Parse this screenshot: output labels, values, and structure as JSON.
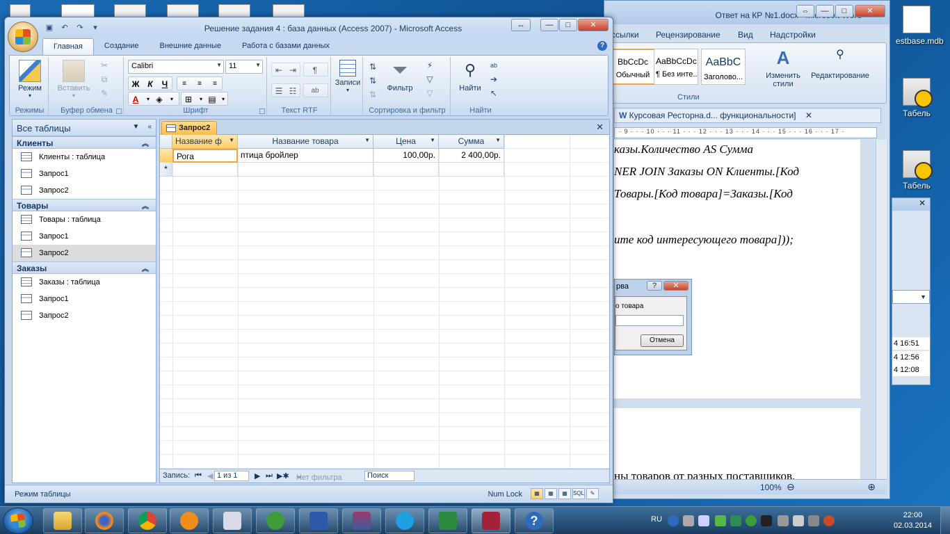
{
  "desktop": {
    "icons": [
      {
        "label": "estbase.mdb"
      },
      {
        "label": "Табель"
      },
      {
        "label": "Табель"
      }
    ]
  },
  "word": {
    "title": "Ответ на КР №1.docx - Microsoft Word",
    "tabs": [
      "ссылки",
      "Рецензирование",
      "Вид",
      "Надстройки"
    ],
    "styles": [
      {
        "preview": "BbCcDc",
        "caption": "Обычный"
      },
      {
        "preview": "AaBbCcDc",
        "caption": "¶ Без инте..."
      },
      {
        "preview": "AaBbC",
        "caption": "Заголово..."
      }
    ],
    "change_styles_label": "Изменить стили",
    "editing_label": "Редактирование",
    "styles_group_caption": "Стили",
    "doc_tab": "Курсовая Ресторна.d... функциональности]",
    "ruler": "· 9 · · · 10 · · · 11 · · · 12 · · · 13 · · · 14 · · · 15 · · · 16 · · · 17 ·",
    "lines": [
      "казы.Количество AS Сумма",
      "NER JOIN Заказы ON Клиенты.[Код",
      "Товары.[Код   товара]=Заказы.[Код",
      "ите код интересующего товара]));"
    ],
    "line_bottom": "ны товаров от разных поставщиков.",
    "dialog_title": "рва",
    "dialog_label": "о товара",
    "dialog_cancel": "Отмена",
    "zoom": "100%"
  },
  "side_window": {
    "times": [
      "4 16:51",
      "4 12:56",
      "4 12:08"
    ]
  },
  "access": {
    "title": "Решение задания 4 : база данных (Access 2007)  -  Microsoft Access",
    "tabs": [
      "Главная",
      "Создание",
      "Внешние данные",
      "Работа с базами данных"
    ],
    "ribbon": {
      "mode_label": "Режим",
      "modes_caption": "Режимы",
      "paste_label": "Вставить",
      "clipboard_caption": "Буфер обмена",
      "font_name": "Calibri",
      "font_size": "11",
      "font_caption": "Шрифт",
      "bold": "Ж",
      "italic": "К",
      "underline": "Ч",
      "rtf_caption": "Текст RTF",
      "records_label": "Записи",
      "filter_label": "Фильтр",
      "sort_caption": "Сортировка и фильтр",
      "find_label": "Найти",
      "find_caption": "Найти"
    },
    "nav": {
      "header": "Все таблицы",
      "groups": [
        {
          "name": "Клиенты",
          "items": [
            "Клиенты : таблица",
            "Запрос1",
            "Запрос2"
          ]
        },
        {
          "name": "Товары",
          "items": [
            "Товары : таблица",
            "Запрос1",
            "Запрос2"
          ]
        },
        {
          "name": "Заказы",
          "items": [
            "Заказы : таблица",
            "Запрос1",
            "Запрос2"
          ]
        }
      ]
    },
    "doc_tab": "Запрос2",
    "grid": {
      "columns": [
        "Название ф",
        "Название товара",
        "Цена",
        "Сумма"
      ],
      "rows": [
        [
          "Рога",
          "птица бройлер",
          "100,00р.",
          "2 400,00р."
        ]
      ],
      "new_row_marker": "*"
    },
    "record_nav": {
      "label": "Запись:",
      "position": "1 из 1",
      "no_filter": "Нет фильтра",
      "search": "Поиск"
    },
    "status": {
      "mode": "Режим таблицы",
      "numlock": "Num Lock"
    }
  },
  "taskbar": {
    "lang": "RU",
    "time": "22:00",
    "date": "02.03.2014"
  }
}
